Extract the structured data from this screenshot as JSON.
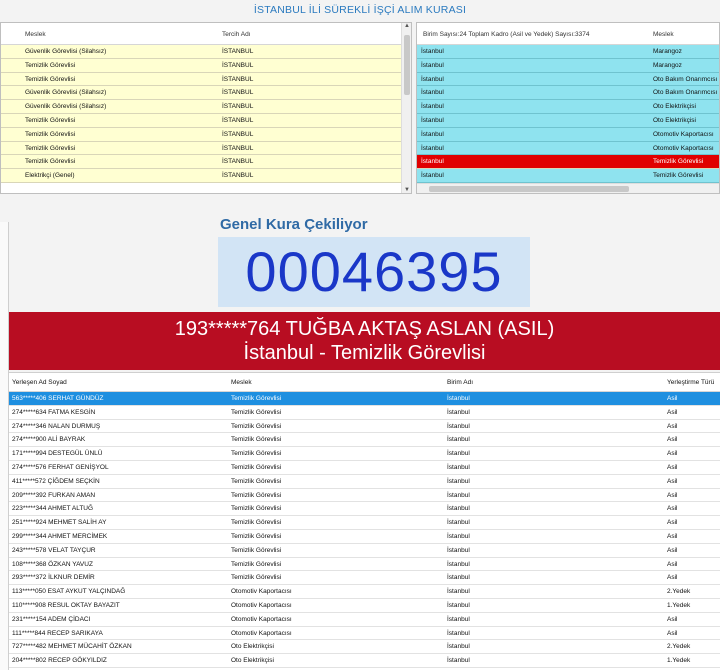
{
  "title": "İSTANBUL İLİ SÜREKLİ İŞÇİ ALIM KURASI",
  "left_grid": {
    "columns": [
      "Meslek",
      "Tercih Adı"
    ],
    "rows": [
      [
        "Güvenlik Görevlisi (Silahsız)",
        "İSTANBUL"
      ],
      [
        "Temizlik Görevlisi",
        "İSTANBUL"
      ],
      [
        "Temizlik Görevlisi",
        "İSTANBUL"
      ],
      [
        "Güvenlik Görevlisi (Silahsız)",
        "İSTANBUL"
      ],
      [
        "Güvenlik Görevlisi (Silahsız)",
        "İSTANBUL"
      ],
      [
        "Temizlik Görevlisi",
        "İSTANBUL"
      ],
      [
        "Temizlik Görevlisi",
        "İSTANBUL"
      ],
      [
        "Temizlik Görevlisi",
        "İSTANBUL"
      ],
      [
        "Temizlik Görevlisi",
        "İSTANBUL"
      ],
      [
        "Elektrikçi (Genel)",
        "İSTANBUL"
      ]
    ]
  },
  "right_grid": {
    "columns": [
      "Birim Sayısı:24 Toplam Kadro (Asil ve Yedek) Sayısı:3374",
      "Meslek"
    ],
    "rows": [
      [
        "İstanbul",
        "Marangoz"
      ],
      [
        "İstanbul",
        "Marangoz"
      ],
      [
        "İstanbul",
        "Oto Bakım Onarımcısı (Ya"
      ],
      [
        "İstanbul",
        "Oto Bakım Onarımcısı (Ya"
      ],
      [
        "İstanbul",
        "Oto Elektrikçisi"
      ],
      [
        "İstanbul",
        "Oto Elektrikçisi"
      ],
      [
        "İstanbul",
        "Otomotiv Kaportacısı"
      ],
      [
        "İstanbul",
        "Otomotiv Kaportacısı"
      ],
      [
        "İstanbul",
        "Temizlik Görevlisi"
      ],
      [
        "İstanbul",
        "Temizlik Görevlisi"
      ]
    ],
    "highlighted_row": 8
  },
  "draw": {
    "caption": "Genel Kura Çekiliyor",
    "number": "00046395",
    "winner_line1": "193*****764 TUĞBA AKTAŞ ASLAN (ASIL)",
    "winner_line2": "İstanbul - Temizlik Görevlisi"
  },
  "results": {
    "columns": [
      "Yerleşen Ad Soyad",
      "Meslek",
      "Birim Adı",
      "Yerleştirme Türü"
    ],
    "rows": [
      [
        "563*****406 SERHAT GÜNDÜZ",
        "Temizlik Görevlisi",
        "İstanbul",
        "Asil"
      ],
      [
        "274*****634 FATMA KESGİN",
        "Temizlik Görevlisi",
        "İstanbul",
        "Asil"
      ],
      [
        "274*****346 NALAN DURMUŞ",
        "Temizlik Görevlisi",
        "İstanbul",
        "Asil"
      ],
      [
        "274*****900 ALİ BAYRAK",
        "Temizlik Görevlisi",
        "İstanbul",
        "Asil"
      ],
      [
        "171*****994 DESTEGÜL ÜNLÜ",
        "Temizlik Görevlisi",
        "İstanbul",
        "Asil"
      ],
      [
        "274*****576 FERHAT GENİŞYOL",
        "Temizlik Görevlisi",
        "İstanbul",
        "Asil"
      ],
      [
        "411*****572 ÇİĞDEM SEÇKİN",
        "Temizlik Görevlisi",
        "İstanbul",
        "Asil"
      ],
      [
        "209*****392 FURKAN AMAN",
        "Temizlik Görevlisi",
        "İstanbul",
        "Asil"
      ],
      [
        "223*****344 AHMET ALTUĞ",
        "Temizlik Görevlisi",
        "İstanbul",
        "Asil"
      ],
      [
        "251*****924 MEHMET SALİH AY",
        "Temizlik Görevlisi",
        "İstanbul",
        "Asil"
      ],
      [
        "299*****344 AHMET MERCİMEK",
        "Temizlik Görevlisi",
        "İstanbul",
        "Asil"
      ],
      [
        "243*****578 VELAT TAYÇUR",
        "Temizlik Görevlisi",
        "İstanbul",
        "Asil"
      ],
      [
        "108*****368 ÖZKAN YAVUZ",
        "Temizlik Görevlisi",
        "İstanbul",
        "Asil"
      ],
      [
        "293*****372 İLKNUR DEMİR",
        "Temizlik Görevlisi",
        "İstanbul",
        "Asil"
      ],
      [
        "113*****050 ESAT AYKUT YALÇINDAĞ",
        "Otomotiv Kaportacısı",
        "İstanbul",
        "2.Yedek"
      ],
      [
        "110*****908 RESUL OKTAY BAYAZIT",
        "Otomotiv Kaportacısı",
        "İstanbul",
        "1.Yedek"
      ],
      [
        "231*****154 ADEM ÇİDACI",
        "Otomotiv Kaportacısı",
        "İstanbul",
        "Asil"
      ],
      [
        "111*****844 RECEP SARIKAYA",
        "Otomotiv Kaportacısı",
        "İstanbul",
        "Asil"
      ],
      [
        "727*****482 MEHMET MÜCAHİT ÖZKAN",
        "Oto Elektrikçisi",
        "İstanbul",
        "2.Yedek"
      ],
      [
        "204*****802 RECEP GÖKYILDIZ",
        "Oto Elektrikçisi",
        "İstanbul",
        "1.Yedek"
      ]
    ],
    "selected_row": 0
  },
  "colors": {
    "title": "#2a7abf",
    "yellow_row": "#ffffd2",
    "cyan_row": "#8fe3ef",
    "highlight_red": "#e00000",
    "banner": "#b80d22",
    "counter": "#1a37c8",
    "counter_bg": "#d2e4f5",
    "selected_blue": "#1e8fe0"
  }
}
